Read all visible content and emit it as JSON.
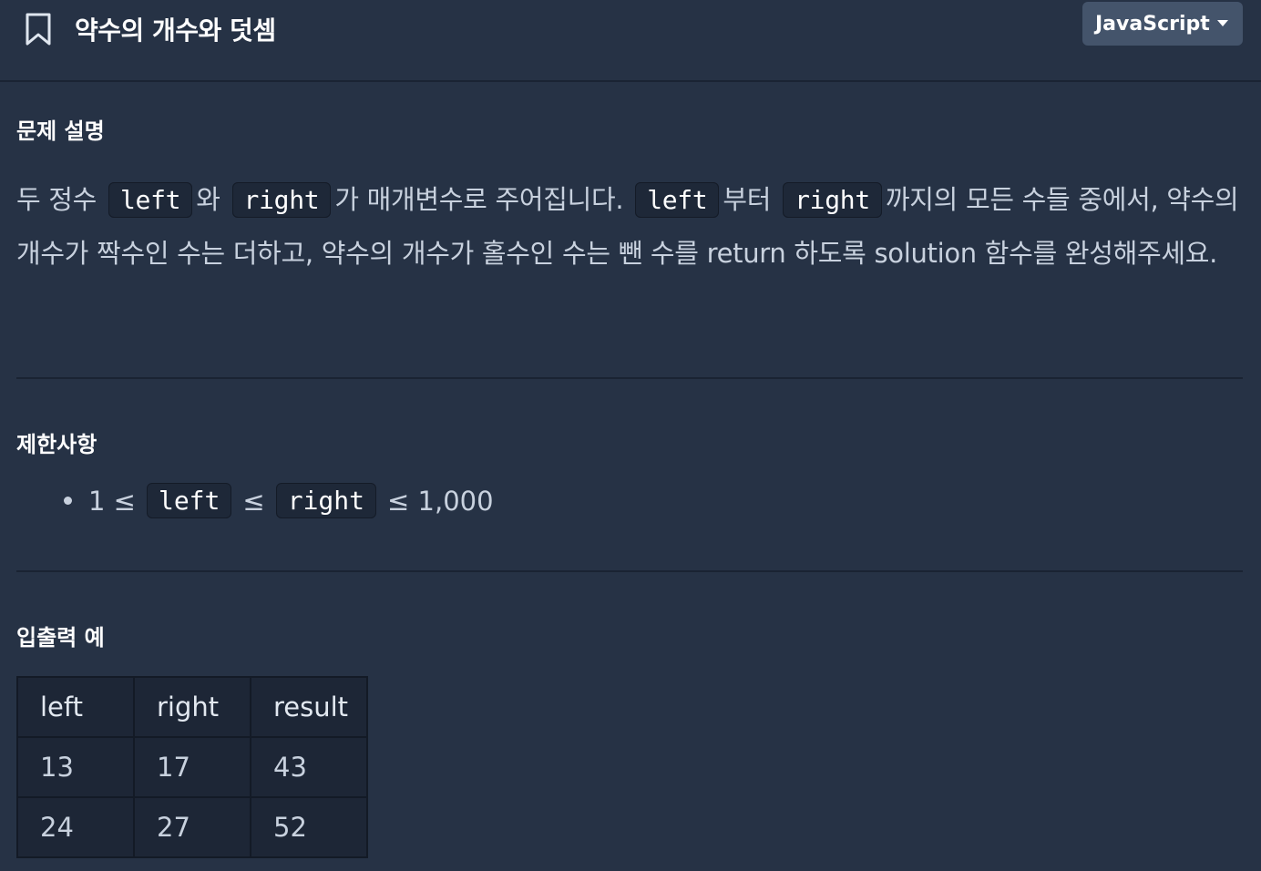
{
  "header": {
    "title": "약수의 개수와 덧셈",
    "language": "JavaScript"
  },
  "problem": {
    "heading": "문제 설명",
    "text": {
      "p1": "두 정수",
      "code1": "left",
      "p2": "와",
      "code2": "right",
      "p3": "가 매개변수로 주어집니다.",
      "code3": "left",
      "p4": "부터",
      "code4": "right",
      "p5": "까지의 모든 수들 중에서, 약수의 개수가 짝수인 수는 더하고, 약수의 개수가 홀수인 수는 뺀 수를 return 하도록 solution 함수를 완성해주세요."
    }
  },
  "constraints": {
    "heading": "제한사항",
    "item": {
      "prefix": "1 ≤",
      "code1": "left",
      "mid": "≤",
      "code2": "right",
      "suffix": "≤ 1,000"
    }
  },
  "io": {
    "heading": "입출력 예",
    "columns": [
      "left",
      "right",
      "result"
    ],
    "rows": [
      [
        "13",
        "17",
        "43"
      ],
      [
        "24",
        "27",
        "52"
      ]
    ]
  }
}
